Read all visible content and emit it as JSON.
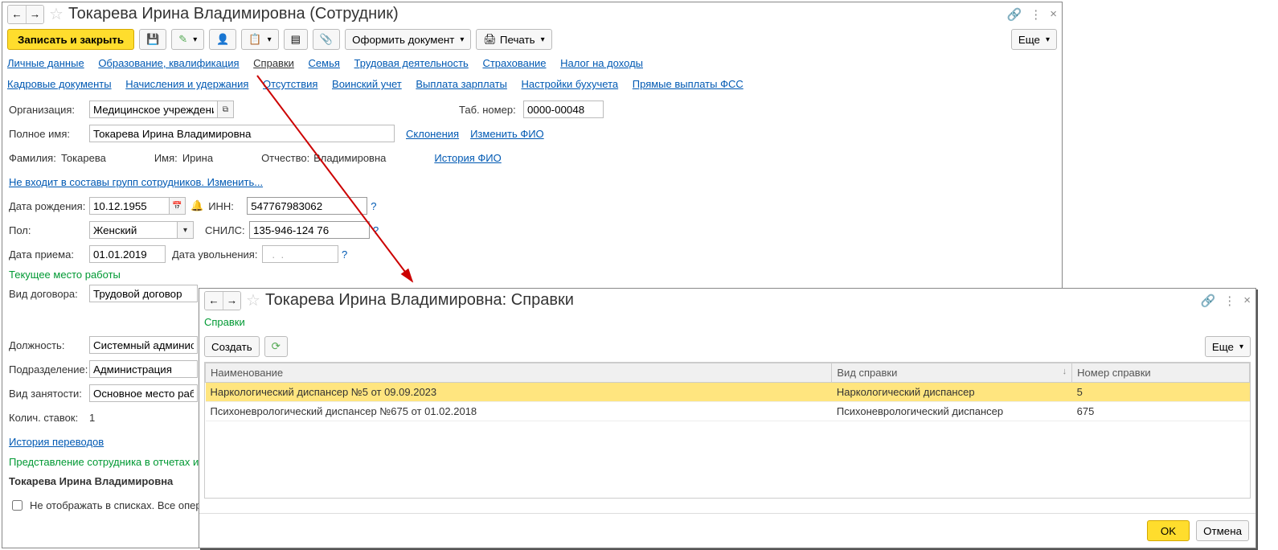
{
  "win1": {
    "title": "Токарева Ирина Владимировна (Сотрудник)",
    "toolbar": {
      "save_close": "Записать и закрыть",
      "create_doc": "Оформить документ",
      "print": "Печать",
      "more": "Еще"
    },
    "tabs_row1": [
      "Личные данные",
      "Образование, квалификация",
      "Справки",
      "Семья",
      "Трудовая деятельность",
      "Страхование",
      "Налог на доходы"
    ],
    "tabs_row2": [
      "Кадровые документы",
      "Начисления и удержания",
      "Отсутствия",
      "Воинский учет",
      "Выплата зарплаты",
      "Настройки бухучета",
      "Прямые выплаты ФСС"
    ],
    "form": {
      "org_label": "Организация:",
      "org_value": "Медицинское учреждени",
      "tabn_label": "Таб. номер:",
      "tabn_value": "0000-00048",
      "fullname_label": "Полное имя:",
      "fullname_value": "Токарева Ирина Владимировна",
      "skl_link": "Склонения",
      "change_fio": "Изменить ФИО",
      "surname_label": "Фамилия:",
      "surname_value": "Токарева",
      "name_label": "Имя:",
      "name_value": "Ирина",
      "patr_label": "Отчество:",
      "patr_value": "Владимировна",
      "history_fio": "История ФИО",
      "groups_link": "Не входит в составы групп сотрудников. Изменить...",
      "dob_label": "Дата рождения:",
      "dob_value": "10.12.1955",
      "inn_label": "ИНН:",
      "inn_value": "547767983062",
      "sex_label": "Пол:",
      "sex_value": "Женский",
      "snils_label": "СНИЛС:",
      "snils_value": "135-946-124 76",
      "hire_label": "Дата приема:",
      "hire_value": "01.01.2019",
      "fire_label": "Дата увольнения:",
      "fire_value": "  .  .    ",
      "current_job": "Текущее место работы",
      "contract_label": "Вид договора:",
      "contract_value": "Трудовой договор",
      "position_label": "Должность:",
      "position_value": "Системный администра",
      "dept_label": "Подразделение:",
      "dept_value": "Администрация",
      "emptype_label": "Вид занятости:",
      "emptype_value": "Основное место рабо",
      "rate_label": "Колич. ставок:",
      "rate_value": "1",
      "history_moves": "История переводов",
      "repr_header": "Представление сотрудника в отчетах и",
      "repr_value": "Токарева Ирина Владимировна",
      "hide_label": "Не отображать в списках. Все опера"
    }
  },
  "win2": {
    "title": "Токарева Ирина Владимировна: Справки",
    "tabs": "Справки",
    "create": "Создать",
    "more": "Еще",
    "columns": {
      "name": "Наименование",
      "type": "Вид справки",
      "num": "Номер справки"
    },
    "rows": [
      {
        "name": "Наркологический диспансер №5 от 09.09.2023",
        "type": "Наркологический диспансер",
        "num": "5"
      },
      {
        "name": "Психоневрологический диспансер №675 от 01.02.2018",
        "type": "Психоневрологический диспансер",
        "num": "675"
      }
    ],
    "ok": "OK",
    "cancel": "Отмена"
  }
}
